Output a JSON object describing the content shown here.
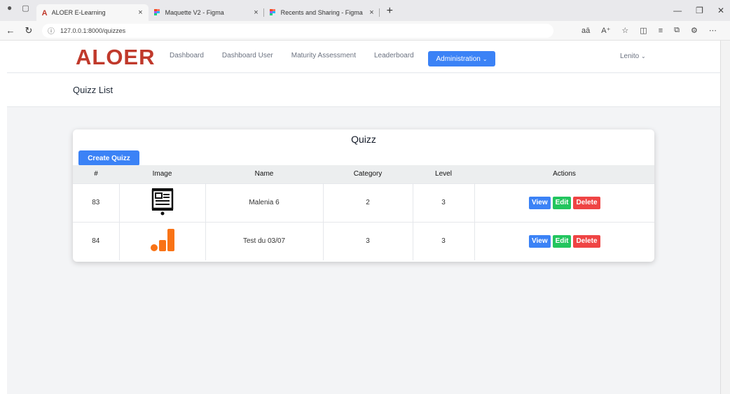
{
  "browser": {
    "tabs": [
      {
        "title": "ALOER E-Learning",
        "active": true,
        "favicon": "aloer-a-icon"
      },
      {
        "title": "Maquette V2 - Figma",
        "active": false,
        "favicon": "figma-icon"
      },
      {
        "title": "Recents and Sharing - Figma",
        "active": false,
        "favicon": "figma-icon"
      }
    ],
    "url": "127.0.0.1:8000/quizzes",
    "accent_red": "#c0392b"
  },
  "app": {
    "logo": "ALOER",
    "nav": {
      "links": [
        "Dashboard",
        "Dashboard User",
        "Maturity Assessment",
        "Leaderboard"
      ],
      "admin": "Administration"
    },
    "user": "Lenito"
  },
  "page": {
    "title": "Quizz List",
    "card_title": "Quizz",
    "create_button": "Create Quizz",
    "columns": [
      "#",
      "Image",
      "Name",
      "Category",
      "Level",
      "Actions"
    ],
    "rows": [
      {
        "id": "83",
        "image": "presentation-board-icon",
        "name": "Malenia 6",
        "category": "2",
        "level": "3"
      },
      {
        "id": "84",
        "image": "bar-chart-orange-icon",
        "name": "Test du 03/07",
        "category": "3",
        "level": "3"
      }
    ],
    "actions": {
      "view": "View",
      "edit": "Edit",
      "delete": "Delete"
    },
    "colors": {
      "primary": "#3b82f6",
      "success": "#22c55e",
      "danger": "#ef4444",
      "orange": "#f97316"
    }
  }
}
